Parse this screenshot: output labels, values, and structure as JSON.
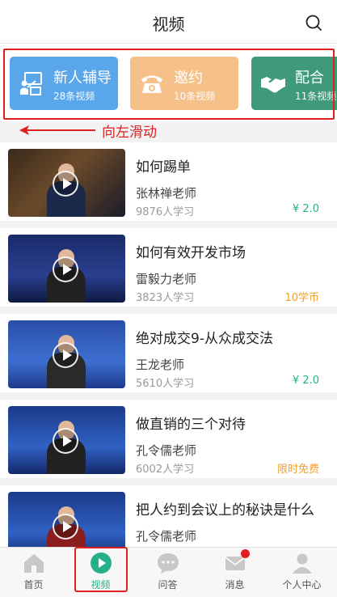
{
  "header": {
    "title": "视频"
  },
  "categories": [
    {
      "title": "新人辅导",
      "count": "28条视频",
      "color": "#5aa6ea",
      "icon": "mentor-icon"
    },
    {
      "title": "邀约",
      "count": "10条视频",
      "color": "#f6c189",
      "icon": "phone-icon"
    },
    {
      "title": "配合",
      "count": "11条视频",
      "color": "#3e9a78",
      "icon": "handshake-icon"
    }
  ],
  "hint": {
    "text": "向左滑动",
    "color": "#e02020"
  },
  "videos": [
    {
      "title": "如何踢单",
      "teacher": "张林禅老师",
      "students": "9876人学习",
      "price": "¥ 2.0",
      "price_color": "#26b089"
    },
    {
      "title": "如何有效开发市场",
      "teacher": "雷毅力老师",
      "students": "3823人学习",
      "price": "10学币",
      "price_color": "#f0a030"
    },
    {
      "title": "绝对成交9-从众成交法",
      "teacher": "王龙老师",
      "students": "5610人学习",
      "price": "¥ 2.0",
      "price_color": "#26b089"
    },
    {
      "title": "做直销的三个对待",
      "teacher": "孔令儒老师",
      "students": "6002人学习",
      "price": "限时免费",
      "price_color": "#f0a030"
    },
    {
      "title": "把人约到会议上的秘诀是什么",
      "teacher": "孔令儒老师",
      "students": "",
      "price": "",
      "price_color": "#26b089"
    }
  ],
  "tabs": [
    {
      "label": "首页",
      "icon": "home-icon"
    },
    {
      "label": "视频",
      "icon": "video-play-icon",
      "active": true
    },
    {
      "label": "问答",
      "icon": "chat-icon"
    },
    {
      "label": "消息",
      "icon": "mail-icon"
    },
    {
      "label": "个人中心",
      "icon": "user-icon"
    }
  ],
  "colors": {
    "accent": "#26b089",
    "highlight": "#e02020"
  }
}
